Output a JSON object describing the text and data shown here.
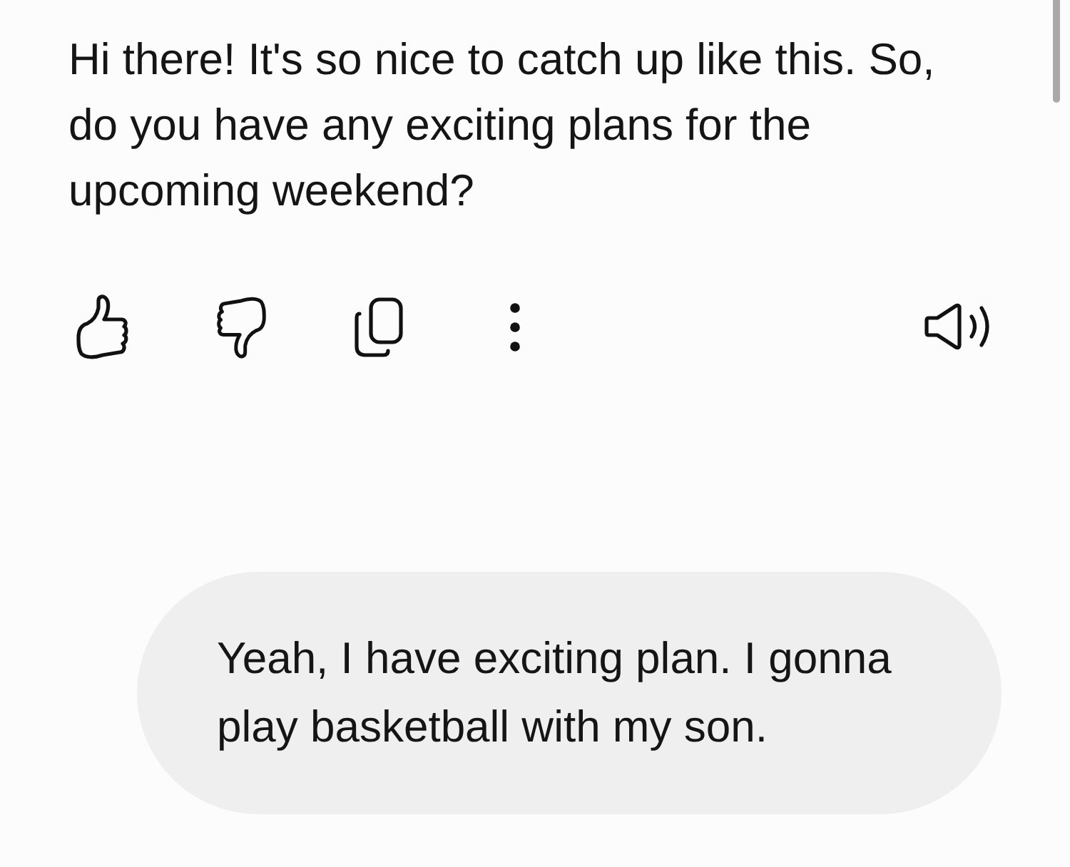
{
  "assistant_message": {
    "text": "Hi there! It's so nice to catch up like this. So, do you have any exciting plans for the upcoming weekend?"
  },
  "user_message": {
    "text": "Yeah, I have exciting plan. I gonna play basketball with my son."
  }
}
